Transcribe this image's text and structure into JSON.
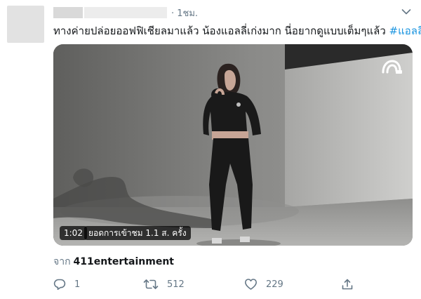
{
  "tweet": {
    "time": "· 1ชม.",
    "text": "ทางค่ายปล่อยออฟฟิเชียลมาแล้ว น้องแอลลี่เก่งมาก นี่อยากดูแบบเต็มๆแล้ว",
    "hashtag": "#แอลลี่"
  },
  "video": {
    "duration": "1:02",
    "views": "ยอดการเข้าชม 1.1 ส. ครั้ง",
    "logo_icon": "channel-logo-icon"
  },
  "source": {
    "lead": "จาก",
    "account": "411entertainment"
  },
  "actions": {
    "reply_count": "1",
    "retweet_count": "512",
    "like_count": "229"
  },
  "colors": {
    "text": "#14171a",
    "secondary": "#657786",
    "link": "#1b95e0"
  }
}
